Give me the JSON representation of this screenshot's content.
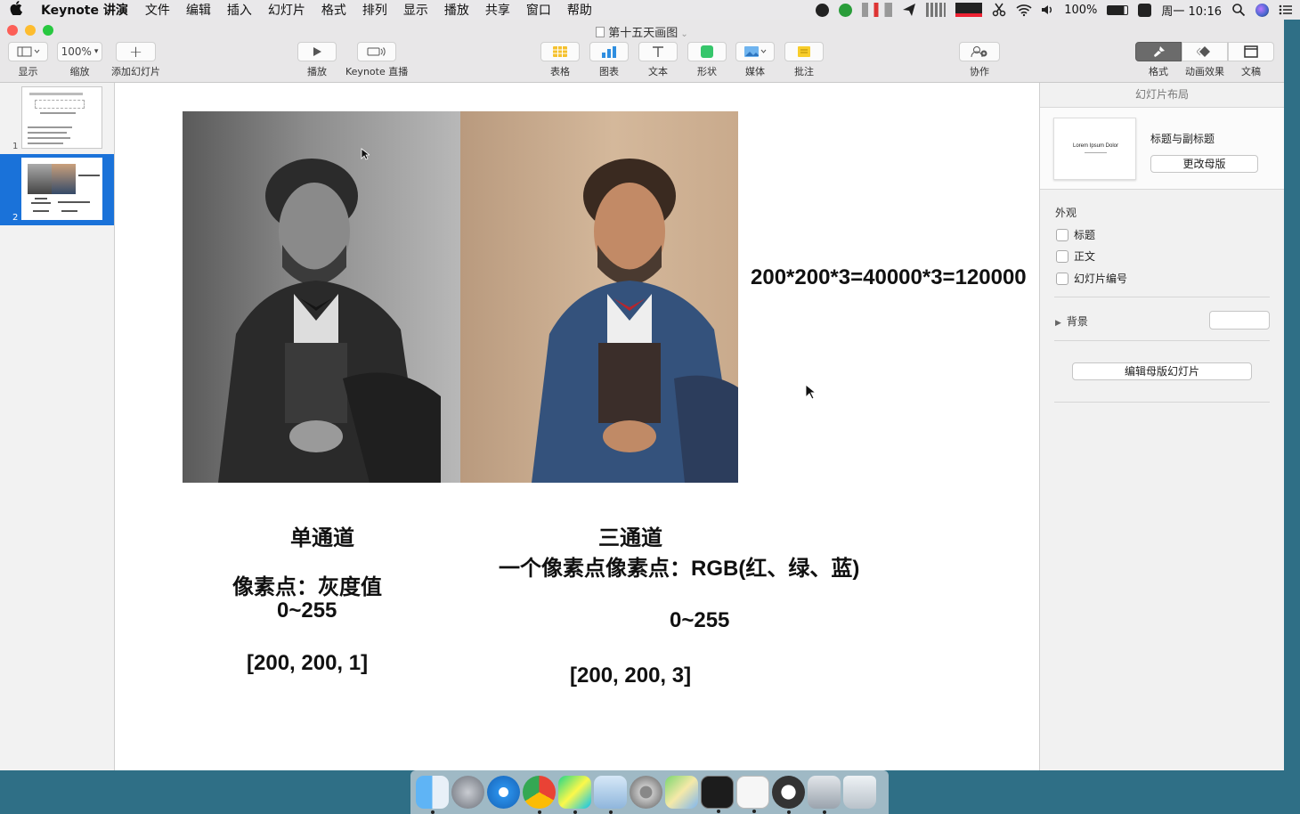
{
  "menubar": {
    "app_name": "Keynote 讲演",
    "items": [
      "文件",
      "编辑",
      "插入",
      "幻灯片",
      "格式",
      "排列",
      "显示",
      "播放",
      "共享",
      "窗口",
      "帮助"
    ],
    "battery": "100%",
    "clock": "周一 10:16"
  },
  "window": {
    "title": "第十五天画图"
  },
  "toolbar": {
    "view_label": "显示",
    "zoom_value": "100%",
    "zoom_label": "缩放",
    "add_slide_label": "添加幻灯片",
    "play_label": "播放",
    "live_label": "Keynote 直播",
    "table_label": "表格",
    "chart_label": "图表",
    "text_label": "文本",
    "shape_label": "形状",
    "media_label": "媒体",
    "comment_label": "批注",
    "collab_label": "协作",
    "format_label": "格式",
    "animate_label": "动画效果",
    "document_label": "文稿"
  },
  "navigator": {
    "slides": [
      {
        "number": "1"
      },
      {
        "number": "2"
      }
    ]
  },
  "slide": {
    "formula": "200*200*3=40000*3=120000",
    "single_channel_title": "单通道",
    "single_pixel_label": "像素点：灰度值",
    "single_range": "0~255",
    "single_shape": "[200, 200, 1]",
    "triple_channel_title": "三通道",
    "triple_pixel_label": "一个像素点像素点：RGB(红、绿、蓝)",
    "triple_range": "0~255",
    "triple_shape": "[200, 200, 3]"
  },
  "inspector": {
    "title": "幻灯片布局",
    "layout_preview_text": "Lorem Ipsum Dolor",
    "layout_name": "标题与副标题",
    "change_master_button": "更改母版",
    "appearance_heading": "外观",
    "checkbox_title": "标题",
    "checkbox_body": "正文",
    "checkbox_slide_number": "幻灯片编号",
    "background_label": "背景",
    "edit_master_button": "编辑母版幻灯片"
  },
  "dock": {
    "apps": [
      "finder-icon",
      "launchpad-icon",
      "safari-icon",
      "chrome-icon",
      "pycharm-icon",
      "keynote-icon",
      "system-preferences-icon",
      "maps-icon",
      "terminal-icon",
      "typora-icon",
      "obs-icon",
      "screenshot-icon",
      "trash-icon"
    ]
  },
  "colors": {
    "accent": "#1a72d9",
    "desktop": "#2f6f86"
  }
}
